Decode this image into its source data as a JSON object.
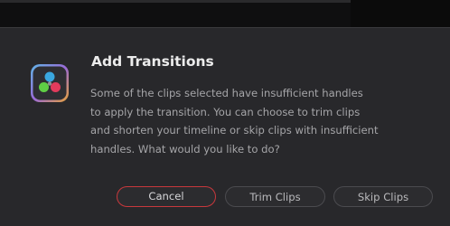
{
  "dialog": {
    "title": "Add Transitions",
    "message_lines": [
      "Some of the clips selected have insufficient handles",
      "to apply the transition. You can choose to trim clips",
      "and shorten your timeline or skip clips with insufficient",
      "handles. What would you like to do?"
    ],
    "buttons": {
      "cancel": "Cancel",
      "trim": "Trim Clips",
      "skip": "Skip Clips"
    },
    "icon": "davinci-resolve-app-icon"
  },
  "colors": {
    "background": "#28282b",
    "cancel_border": "#c8383c",
    "title": "#ececec",
    "text": "#a5a5a8"
  }
}
